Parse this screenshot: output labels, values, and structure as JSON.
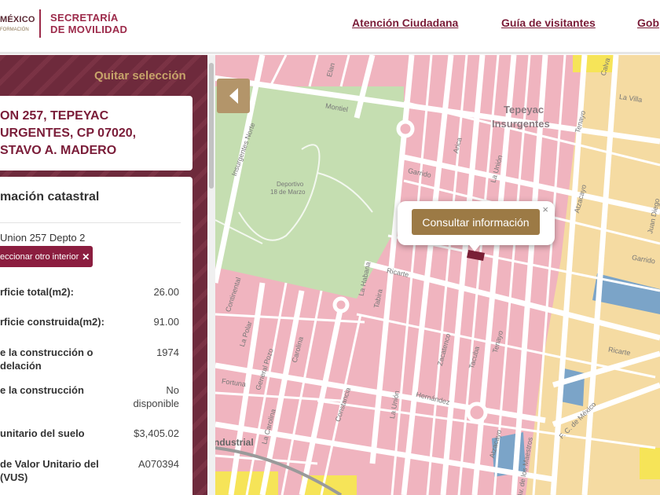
{
  "header": {
    "gov_logo_top": "MÉXICO",
    "gov_logo_bottom": "FORMACIÓN",
    "secretaria_line1": "SECRETARÍA",
    "secretaria_line2": "DE MOVILIDAD",
    "nav": [
      {
        "label": "Atención Ciudadana"
      },
      {
        "label": "Guía de visitantes"
      },
      {
        "label": "Gob"
      }
    ]
  },
  "panel": {
    "quitar_label": "Quitar selección",
    "address_lines": [
      "ON 257, TEPEYAC",
      "URGENTES, CP 07020,",
      "STAVO A. MADERO"
    ],
    "info_title": "mación catastral",
    "unit_label": "Union 257 Depto 2",
    "interior_button": "eccionar otro interior",
    "rows": [
      {
        "label": "rficie total(m2):",
        "value": "26.00"
      },
      {
        "label": "rficie construida(m2):",
        "value": "91.00"
      },
      {
        "label": "e la construcción o\ndelación",
        "value": "1974"
      },
      {
        "label": "e la construcción",
        "value": "No\ndisponible"
      },
      {
        "label": "unitario del suelo",
        "value": "$3,405.02"
      },
      {
        "label": "de Valor Unitario del\n(VUS)",
        "value": "A070394"
      }
    ]
  },
  "map": {
    "popup_button": "Consultar información",
    "popup_close": "×",
    "place_labels": [
      "Tepeyac",
      "Insurgentes",
      "Deportivo",
      "18 de Marzo",
      "ndustrial"
    ],
    "street_labels": [
      "Elan",
      "Montiel",
      "Garrido",
      "Arica",
      "La Unión",
      "Tenayo",
      "Atzacayo",
      "Ricarte",
      "La Habana",
      "Tabira",
      "La Villa",
      "Calva",
      "Garrido",
      "Juan Diego",
      "Insurgentes Norte",
      "La Polar",
      "Carolina",
      "Ricarte",
      "Hernández",
      "Zacatenco",
      "Tacuba",
      "Tenayo",
      "Fortuna",
      "General Pozo",
      "La Carolina",
      "Constancia",
      "La Unión",
      "F. C. de México",
      "Atzacayo",
      "Av. de los Maestros",
      "Continental"
    ],
    "colors": {
      "block": "#f0b4bf",
      "block_border": "#e59aa8",
      "park": "#c5deb1",
      "commercial": "#f5dba2",
      "yellow": "#f6e458",
      "blue": "#7ba4c8",
      "selected": "#7a2036",
      "road": "#ffffff"
    }
  }
}
